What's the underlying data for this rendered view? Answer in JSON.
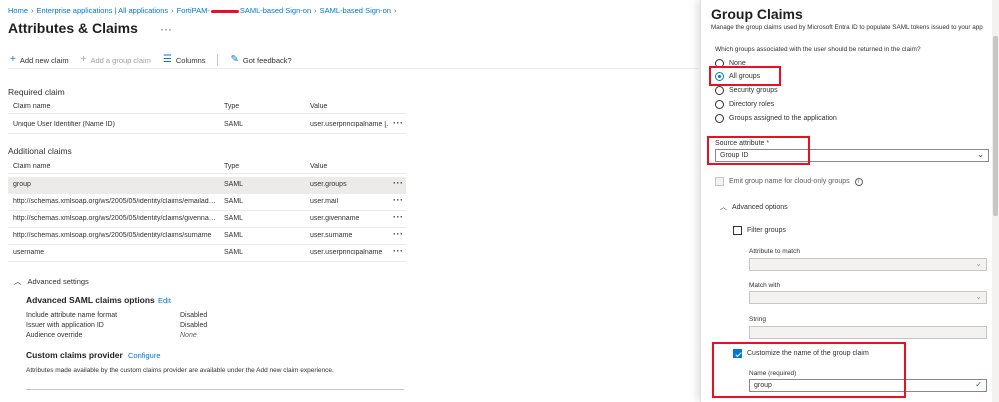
{
  "breadcrumb": {
    "home": "Home",
    "apps": "Enterprise applications | All applications",
    "app_prefix": "FortiPAM-",
    "app_suffix": "SAML-based Sign-on",
    "current": "SAML-based Sign-on"
  },
  "page": {
    "title": "Attributes & Claims",
    "more": "···"
  },
  "toolbar": {
    "add_claim": "Add new claim",
    "add_group_claim": "Add a group claim",
    "columns": "Columns",
    "feedback": "Got feedback?"
  },
  "required": {
    "label": "Required claim",
    "headers": [
      "Claim name",
      "Type",
      "Value"
    ],
    "rows": [
      {
        "name": "Unique User Identifier (Name ID)",
        "type": "SAML",
        "value": "user.userprincipalname [..."
      }
    ]
  },
  "additional": {
    "label": "Additional claims",
    "headers": [
      "Claim name",
      "Type",
      "Value"
    ],
    "rows": [
      {
        "name": "group",
        "type": "SAML",
        "value": "user.groups"
      },
      {
        "name": "http://schemas.xmlsoap.org/ws/2005/05/identity/claims/emailadd...",
        "type": "SAML",
        "value": "user.mail"
      },
      {
        "name": "http://schemas.xmlsoap.org/ws/2005/05/identity/claims/givenname",
        "type": "SAML",
        "value": "user.givenname"
      },
      {
        "name": "http://schemas.xmlsoap.org/ws/2005/05/identity/claims/surname",
        "type": "SAML",
        "value": "user.surname"
      },
      {
        "name": "username",
        "type": "SAML",
        "value": "user.userprincipalname"
      }
    ],
    "more": "···"
  },
  "advanced_settings": {
    "label": "Advanced settings",
    "saml_title": "Advanced SAML claims options",
    "edit": "Edit",
    "items": [
      {
        "key": "Include attribute name format",
        "value": "Disabled"
      },
      {
        "key": "Issuer with application ID",
        "value": "Disabled"
      },
      {
        "key": "Audience override",
        "value": "None"
      }
    ],
    "ccp_title": "Custom claims provider",
    "configure": "Configure",
    "ccp_desc": "Attributes made available by the custom claims provider are available under the Add new claim experience."
  },
  "panel": {
    "title": "Group Claims",
    "subtitle": "Manage the group claims used by Microsoft Entra ID to populate SAML tokens issued to your app",
    "question": "Which groups associated with the user should be returned in the claim?",
    "options": [
      "None",
      "All groups",
      "Security groups",
      "Directory roles",
      "Groups assigned to the application"
    ],
    "selected_index": 1,
    "source_label": "Source attribute",
    "source_required": "*",
    "source_value": "Group ID",
    "emit_label": "Emit group name for cloud-only groups",
    "advanced_label": "Advanced options",
    "filter_label": "Filter groups",
    "attr_match_label": "Attribute to match",
    "match_with_label": "Match with",
    "string_label": "String",
    "customize_label": "Customize the name of the group claim",
    "name_label": "Name (required)",
    "name_value": "group"
  },
  "colors": {
    "accent": "#0078d4",
    "highlight": "#e81123"
  }
}
